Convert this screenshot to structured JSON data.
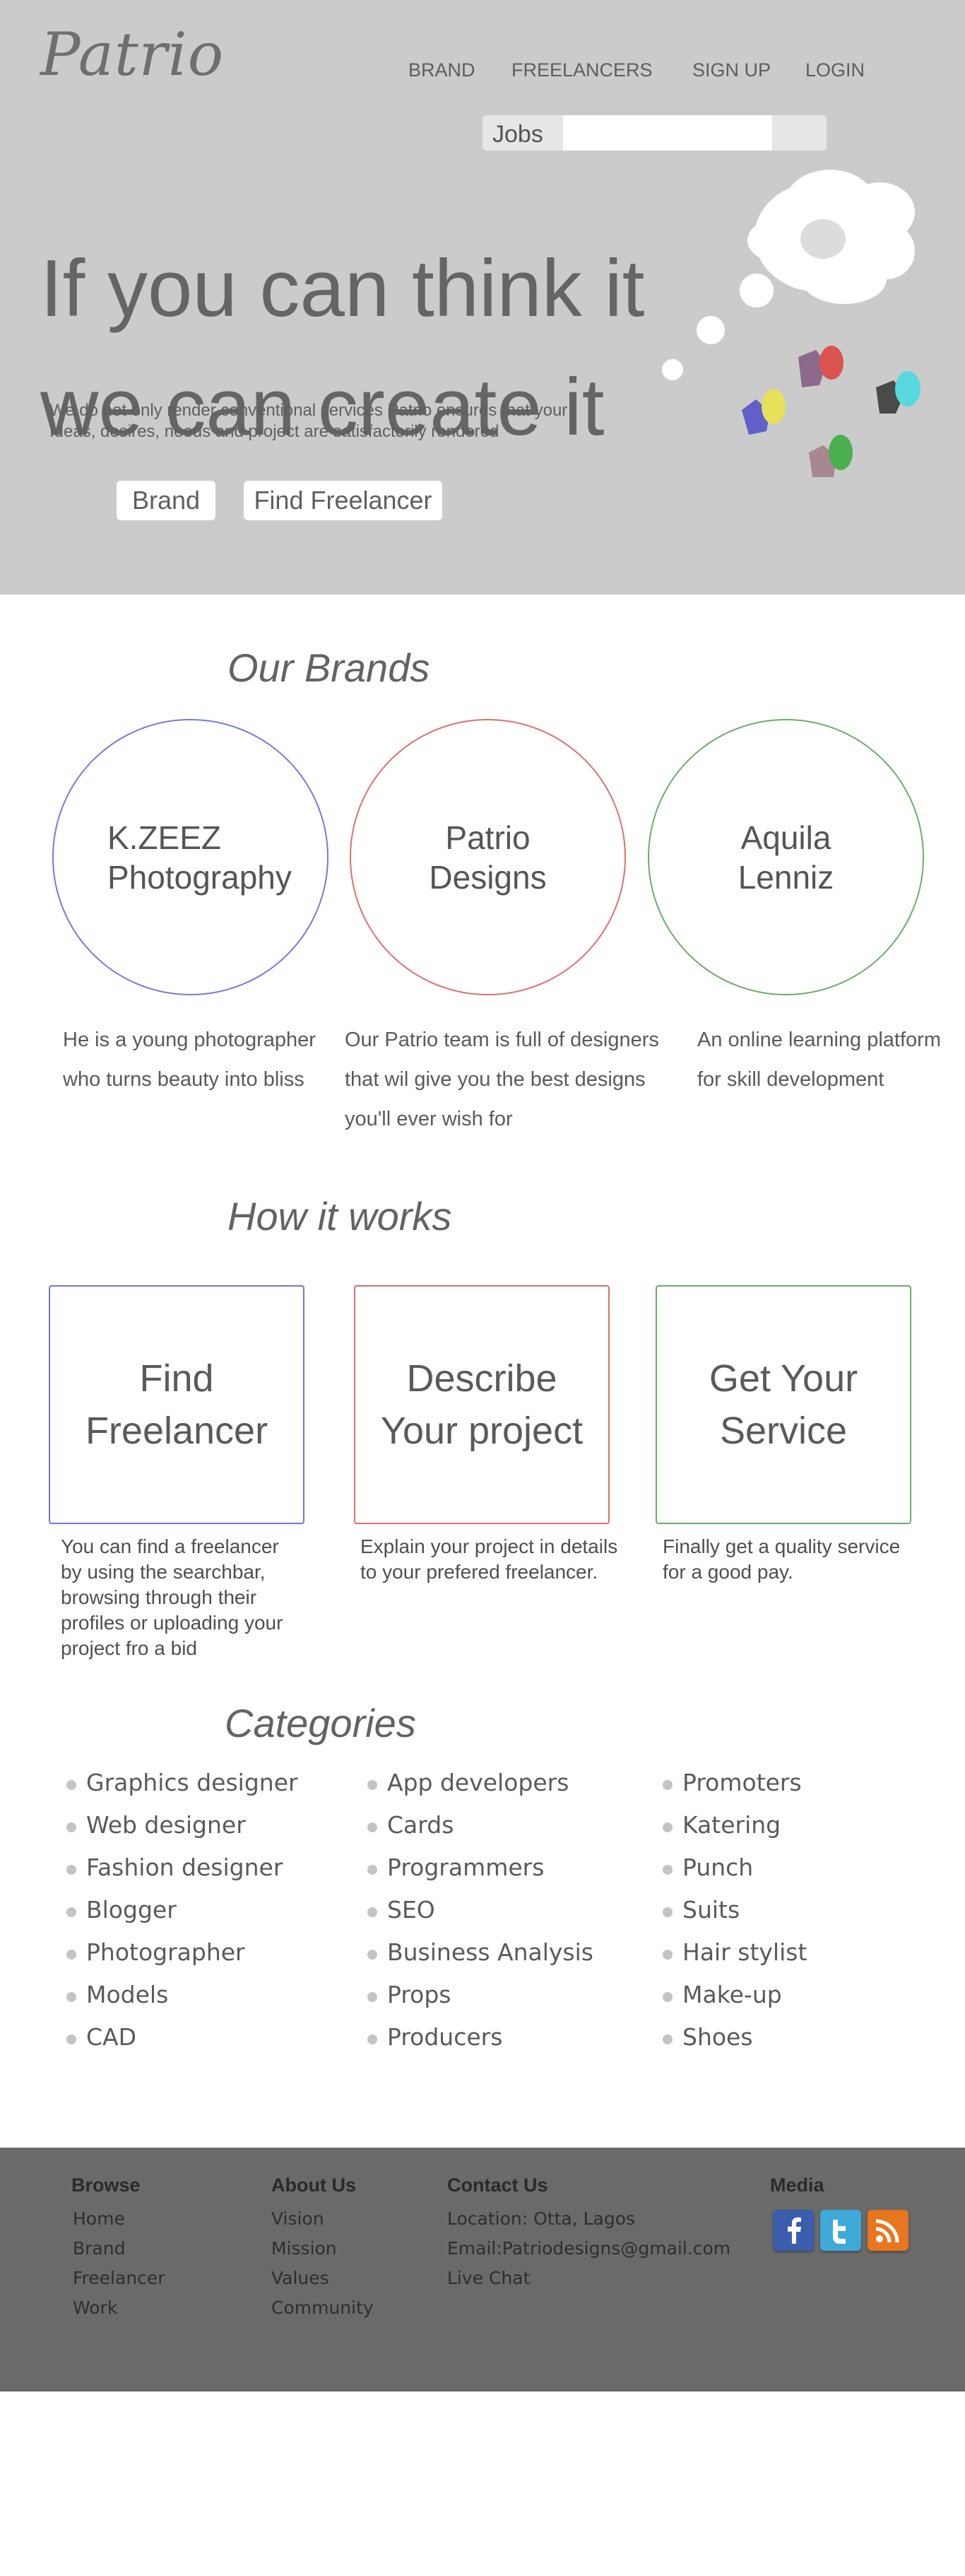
{
  "header": {
    "logo": "Patrio",
    "nav": [
      "BRAND",
      "FREELANCERS",
      "SIGN UP",
      "LOGIN"
    ],
    "search": {
      "label": "Jobs",
      "placeholder": ""
    }
  },
  "hero": {
    "headline_line1": "If you can think it",
    "headline_line2": "we can create it",
    "subtext_line1": "We do not only render conventional services Patrio ensures that your",
    "subtext_line2": "Ideas, desires, needs and project are satisfactorily rendered",
    "buttons": [
      "Brand",
      "Find Freelancer"
    ]
  },
  "brands": {
    "title": "Our Brands",
    "items": [
      {
        "name_line1": "K.ZEEZ",
        "name_line2": "Photography",
        "desc_line1": "He is a young photographer",
        "desc_line2": "who turns beauty into bliss",
        "desc_line3": "",
        "color": "#7878e0"
      },
      {
        "name_line1": "Patrio",
        "name_line2": "Designs",
        "desc_line1": "Our Patrio team is full of designers",
        "desc_line2": "that wil give you the best designs",
        "desc_line3": "you'll ever wish for",
        "color": "#e07070"
      },
      {
        "name_line1": "Aquila",
        "name_line2": "Lenniz",
        "desc_line1": "An online learning platform",
        "desc_line2": "for skill development",
        "desc_line3": "",
        "color": "#6aae6a"
      }
    ]
  },
  "how": {
    "title": "How it works",
    "steps": [
      {
        "title_line1": "Find",
        "title_line2": "Freelancer",
        "desc": [
          "You can find a freelancer",
          "by using the searchbar,",
          "browsing through their",
          "profiles or uploading your",
          "project fro a bid"
        ],
        "color": "#7474dc"
      },
      {
        "title_line1": "Describe",
        "title_line2": "Your project",
        "desc": [
          "Explain your project in details",
          "to your prefered freelancer."
        ],
        "color": "#dc6e6e"
      },
      {
        "title_line1": "Get Your",
        "title_line2": "Service",
        "desc": [
          "Finally get a quality service",
          "for a good pay."
        ],
        "color": "#6aac6a"
      }
    ]
  },
  "categories": {
    "title": "Categories",
    "col1": [
      "Graphics designer",
      "Web designer",
      "Fashion designer",
      "Blogger",
      "Photographer",
      "Models",
      "CAD"
    ],
    "col2": [
      "App developers",
      "Cards",
      "Programmers",
      "SEO",
      "Business Analysis",
      "Props",
      "Producers"
    ],
    "col3": [
      "Promoters",
      "Katering",
      "Punch",
      "Suits",
      "Hair stylist",
      "Make-up",
      "Shoes"
    ]
  },
  "footer": {
    "browse": {
      "title": "Browse",
      "links": [
        "Home",
        "Brand",
        "Freelancer",
        "Work"
      ]
    },
    "about": {
      "title": "About Us",
      "links": [
        "Vision",
        "Mission",
        "Values",
        "Community"
      ]
    },
    "contact": {
      "title": "Contact Us",
      "links": [
        "Location: Otta, Lagos",
        "Email:Patriodesigns@gmail.com",
        "Live Chat"
      ]
    },
    "media": {
      "title": "Media",
      "icons": [
        "facebook-icon",
        "twitter-icon",
        "rss-icon"
      ],
      "colors": [
        "#3b5eac",
        "#3fa9d8",
        "#e8761e"
      ]
    }
  }
}
